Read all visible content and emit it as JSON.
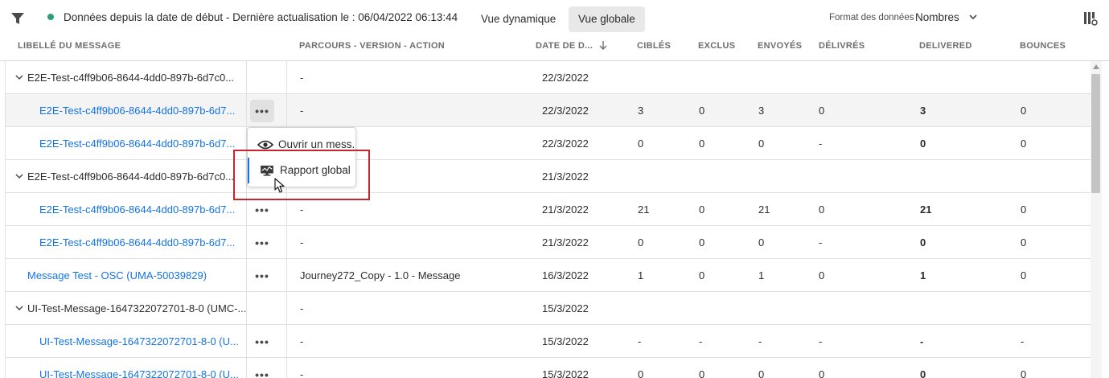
{
  "toolbar": {
    "status_text": "Données depuis la date de début - Dernière actualisation le : 06/04/2022 06:13:44",
    "status_color": "#2d9d78",
    "btn_dynamic": "Vue dynamique",
    "btn_global": "Vue globale",
    "format_label": "Format des données",
    "format_value": "Nombres",
    "icons": [
      "filter-icon",
      "chevron-down-icon",
      "column-settings-icon"
    ]
  },
  "header": {
    "col_message": "LIBELLÉ DU MESSAGE",
    "col_journey": "PARCOURS - VERSION - ACTION",
    "col_date": "DATE DE D...",
    "col_targeted": "CIBLÉS",
    "col_excluded": "EXCLUS",
    "col_sent": "ENVOYÉS",
    "col_delivered_fr": "DÉLIVRÉS",
    "col_delivered": "DELIVERED",
    "col_bounces": "BOUNCES"
  },
  "rows": [
    {
      "name": "E2E-Test-c4ff9b06-8644-4dd0-897b-6d7c0...",
      "journey": "-",
      "date": "22/3/2022",
      "targeted": "",
      "excluded": "",
      "sent": "",
      "delivered_fr": "",
      "delivered": "",
      "bounces": ""
    },
    {
      "name": "E2E-Test-c4ff9b06-8644-4dd0-897b-6d7...",
      "journey": "-",
      "date": "22/3/2022",
      "targeted": "3",
      "excluded": "0",
      "sent": "3",
      "delivered_fr": "0",
      "delivered": "3",
      "bounces": "0"
    },
    {
      "name": "E2E-Test-c4ff9b06-8644-4dd0-897b-6d7...",
      "journey": "-",
      "date": "22/3/2022",
      "targeted": "0",
      "excluded": "0",
      "sent": "0",
      "delivered_fr": "-",
      "delivered": "0",
      "bounces": "0"
    },
    {
      "name": "E2E-Test-c4ff9b06-8644-4dd0-897b-6d7c0...",
      "journey": "",
      "date": "21/3/2022",
      "targeted": "",
      "excluded": "",
      "sent": "",
      "delivered_fr": "",
      "delivered": "",
      "bounces": ""
    },
    {
      "name": "E2E-Test-c4ff9b06-8644-4dd0-897b-6d7...",
      "journey": "-",
      "date": "21/3/2022",
      "targeted": "21",
      "excluded": "0",
      "sent": "21",
      "delivered_fr": "0",
      "delivered": "21",
      "bounces": "0"
    },
    {
      "name": "E2E-Test-c4ff9b06-8644-4dd0-897b-6d7...",
      "journey": "-",
      "date": "21/3/2022",
      "targeted": "0",
      "excluded": "0",
      "sent": "0",
      "delivered_fr": "-",
      "delivered": "0",
      "bounces": "0"
    },
    {
      "name": "Message Test - OSC (UMA-50039829)",
      "journey": "Journey272_Copy - 1.0 - Message",
      "date": "16/3/2022",
      "targeted": "1",
      "excluded": "0",
      "sent": "1",
      "delivered_fr": "0",
      "delivered": "1",
      "bounces": "0"
    },
    {
      "name": "UI-Test-Message-1647322072701-8-0 (UMC-...",
      "journey": "-",
      "date": "15/3/2022",
      "targeted": "",
      "excluded": "",
      "sent": "",
      "delivered_fr": "",
      "delivered": "",
      "bounces": ""
    },
    {
      "name": "UI-Test-Message-1647322072701-8-0 (U...",
      "journey": "-",
      "date": "15/3/2022",
      "targeted": "-",
      "excluded": "-",
      "sent": "-",
      "delivered_fr": "-",
      "delivered": "-",
      "bounces": "-"
    },
    {
      "name": "UI-Test-Message-1647322072701-8-0 (U...",
      "journey": "-",
      "date": "15/3/2022",
      "targeted": "0",
      "excluded": "0",
      "sent": "0",
      "delivered_fr": "0",
      "delivered": "0",
      "bounces": "0"
    }
  ],
  "more_label": "•••",
  "menu": {
    "open_label": "Ouvrir un mess...",
    "report_label": "Rapport global",
    "icons": [
      "eye-icon",
      "report-icon"
    ]
  },
  "colors": {
    "link": "#1473e6",
    "highlight": "#c9252d",
    "selected_bg": "#e8e8e8"
  }
}
